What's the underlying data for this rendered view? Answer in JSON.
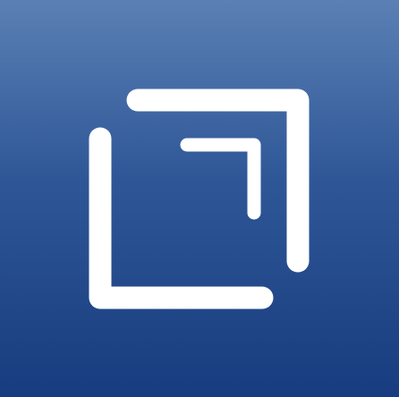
{
  "icon": {
    "name": "nested-corner-brackets-icon",
    "background_top_color": "#5a80b4",
    "background_bottom_color": "#173c7f",
    "foreground_color": "#ffffff"
  }
}
